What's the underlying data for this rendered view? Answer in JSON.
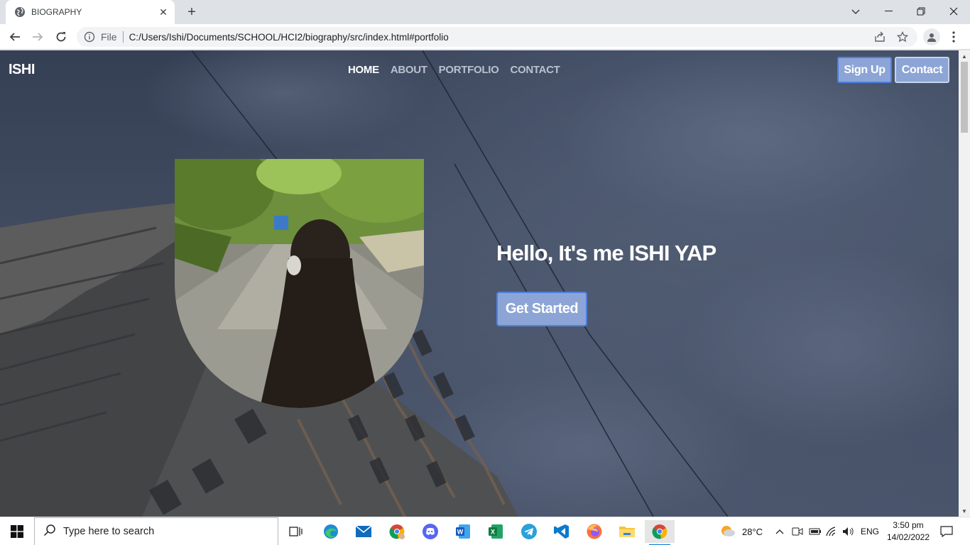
{
  "browser": {
    "tab_title": "BIOGRAPHY",
    "scheme_label": "File",
    "url": "C:/Users/Ishi/Documents/SCHOOL/HCI2/biography/src/index.html#portfolio"
  },
  "site": {
    "brand": "ISHI",
    "nav": [
      {
        "label": "HOME",
        "active": true
      },
      {
        "label": "ABOUT",
        "active": false
      },
      {
        "label": "PORTFOLIO",
        "active": false
      },
      {
        "label": "CONTACT",
        "active": false
      }
    ],
    "signup_label": "Sign Up",
    "contact_label": "Contact",
    "hero_title": "Hello, It's me ISHI YAP",
    "cta_label": "Get Started"
  },
  "taskbar": {
    "search_placeholder": "Type here to search",
    "weather": "28°C",
    "language": "ENG",
    "time": "3:50 pm",
    "date": "14/02/2022"
  },
  "colors": {
    "accent_button": "#8ca5d6",
    "button_border": "#4f7fe0"
  }
}
